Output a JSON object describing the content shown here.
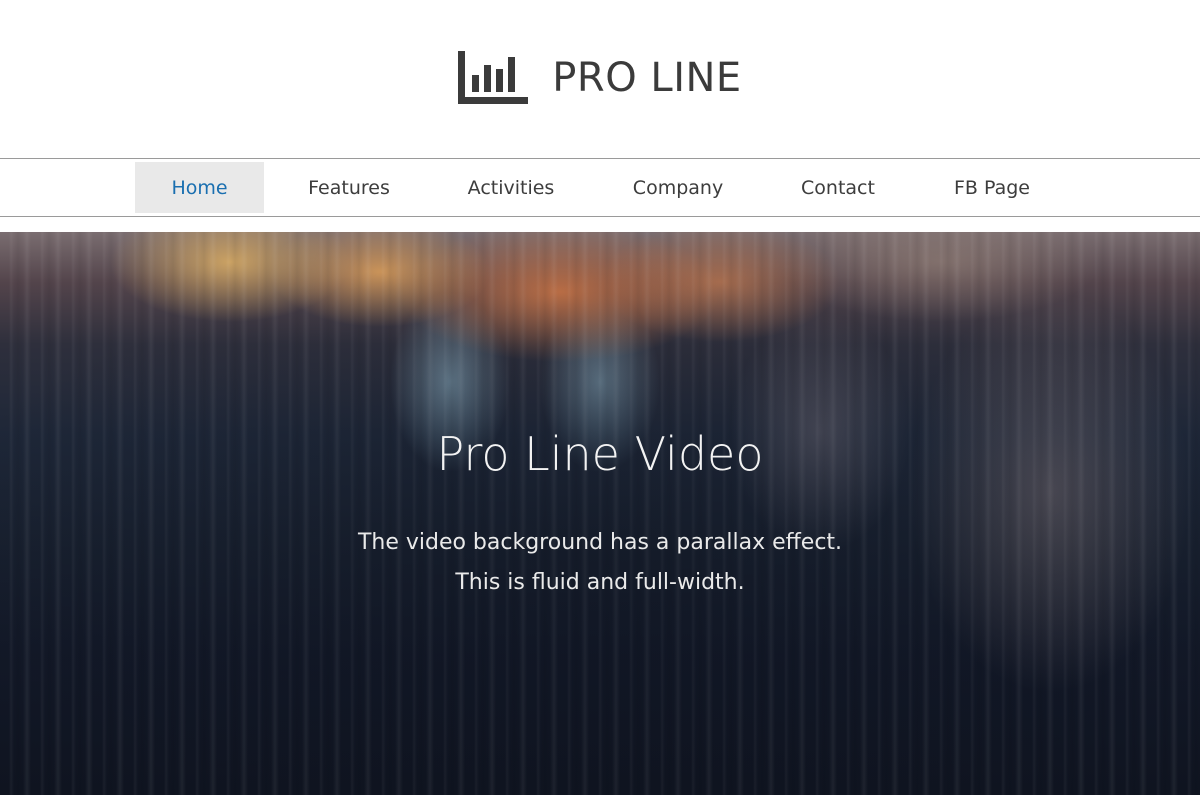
{
  "header": {
    "brand_name": "PRO LINE",
    "logo_icon": "bar-chart-icon",
    "brand_color": "#3b3b3b"
  },
  "nav": {
    "items": [
      {
        "label": "Home",
        "active": true
      },
      {
        "label": "Features",
        "active": false
      },
      {
        "label": "Activities",
        "active": false
      },
      {
        "label": "Company",
        "active": false
      },
      {
        "label": "Contact",
        "active": false
      },
      {
        "label": "FB Page",
        "active": false
      }
    ],
    "active_color": "#1a6fb0",
    "active_bg": "#e9e9e9"
  },
  "hero": {
    "title": "Pro Line Video",
    "lines": [
      "The video background has a parallax effect.",
      "This is fluid and full-width."
    ]
  }
}
